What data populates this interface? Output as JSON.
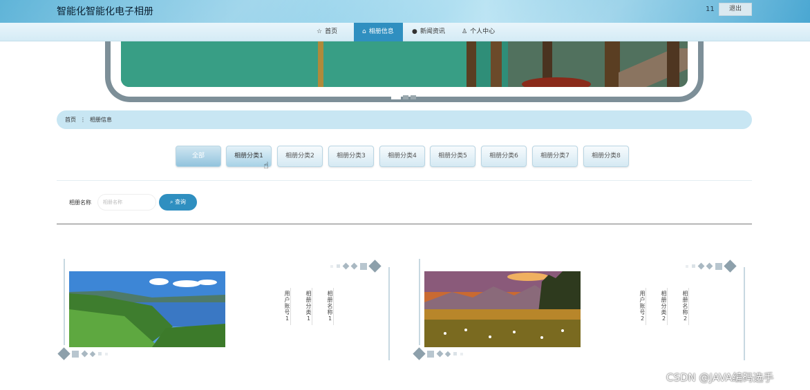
{
  "header": {
    "title": "智能化智能化电子相册",
    "user": "11",
    "logout": "退出"
  },
  "nav": [
    {
      "label": "首页",
      "icon": "star-icon"
    },
    {
      "label": "相册信息",
      "icon": "home-icon"
    },
    {
      "label": "新闻资讯",
      "icon": "info-icon"
    },
    {
      "label": "个人中心",
      "icon": "user-icon"
    }
  ],
  "breadcrumb": {
    "home": "首页",
    "sep": "⋮",
    "current": "相册信息"
  },
  "categories": [
    "全部",
    "相册分类1",
    "相册分类2",
    "相册分类3",
    "相册分类4",
    "相册分类5",
    "相册分类6",
    "相册分类7",
    "相册分类8"
  ],
  "search": {
    "label": "相册名称",
    "placeholder": "相册名称",
    "button": "查询"
  },
  "cards": [
    {
      "col1": "用户账号1",
      "col2": "相册分类1",
      "col3": "相册名称1"
    },
    {
      "col1": "用户账号2",
      "col2": "相册分类2",
      "col3": "相册名称2"
    }
  ],
  "watermark": "CSDN @JAVA编码选手",
  "colors": {
    "accent": "#2f8fc0",
    "breadcrumb": "#c8e6f3"
  }
}
